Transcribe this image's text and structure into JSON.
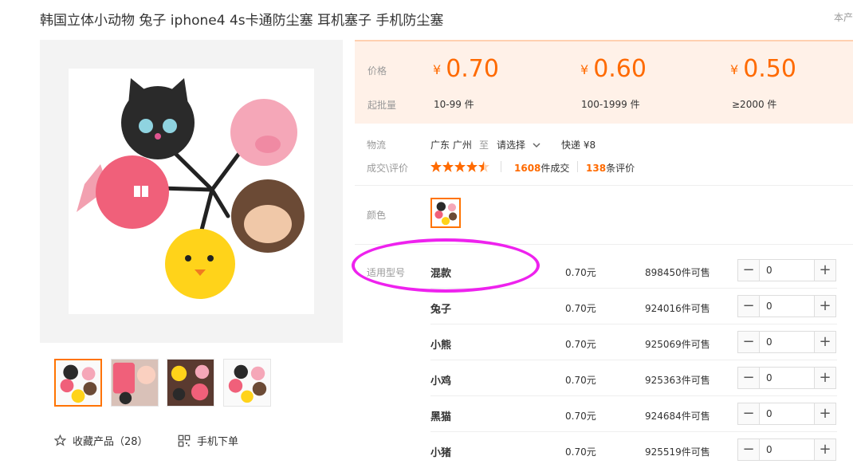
{
  "product": {
    "title": "韩国立体小动物 兔子 iphone4 4s卡通防尘塞 耳机塞子 手机防尘塞",
    "corner_text": "本产"
  },
  "pricing": {
    "price_label": "价格",
    "moq_label": "起批量",
    "currency": "¥",
    "tiers": [
      {
        "price": "0.70",
        "range": "10-99 件"
      },
      {
        "price": "0.60",
        "range": "100-1999 件"
      },
      {
        "price": "0.50",
        "range": "≥2000 件"
      }
    ]
  },
  "logistics": {
    "label": "物流",
    "from": "广东 广州",
    "to_word": "至",
    "destination": "请选择",
    "shipping": "快递 ¥8"
  },
  "deals": {
    "label": "成交\\评价",
    "rating": 4.5,
    "deal_count": "1608",
    "deal_suffix": "件成交",
    "review_count": "138",
    "review_suffix": "条评价"
  },
  "color": {
    "label": "颜色"
  },
  "sku": {
    "label": "适用型号",
    "rows": [
      {
        "name": "混款",
        "price": "0.70元",
        "stock": "898450件可售",
        "qty": "0"
      },
      {
        "name": "兔子",
        "price": "0.70元",
        "stock": "924016件可售",
        "qty": "0"
      },
      {
        "name": "小熊",
        "price": "0.70元",
        "stock": "925069件可售",
        "qty": "0"
      },
      {
        "name": "小鸡",
        "price": "0.70元",
        "stock": "925363件可售",
        "qty": "0"
      },
      {
        "name": "黑猫",
        "price": "0.70元",
        "stock": "924684件可售",
        "qty": "0"
      },
      {
        "name": "小猪",
        "price": "0.70元",
        "stock": "925519件可售",
        "qty": "0"
      }
    ],
    "minus": "−",
    "plus": "+"
  },
  "actions": {
    "favorite": "收藏产品（28）",
    "mobile_order": "手机下单"
  },
  "colors": {
    "accent": "#ff6a00",
    "price_bg": "#fff1e8",
    "highlight_ellipse": "#ee22ee"
  },
  "icons": [
    "star-outline-icon",
    "qr-code-icon",
    "chevron-down-icon",
    "star-icon"
  ]
}
